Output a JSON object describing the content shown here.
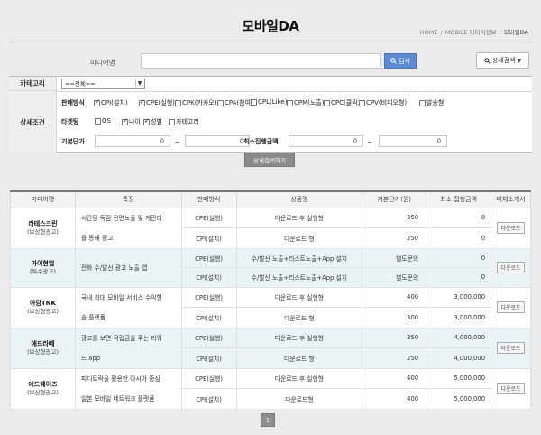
{
  "header": {
    "title": "모바일DA",
    "breadcrumb": [
      "HOME",
      "MOBILE 미디어정보",
      "모바일DA"
    ]
  },
  "search": {
    "media_label": "미디어명",
    "media_value": "",
    "search_button": "검색",
    "advanced_toggle": "상세검색"
  },
  "conditions": {
    "category_label": "카테고리",
    "category_selected": "==전체==",
    "detail_label": "상세조건",
    "sale_label": "판매방식",
    "sale_options": [
      {
        "label": "CPI(설치)",
        "checked": true
      },
      {
        "label": "CPE(실행)",
        "checked": true
      },
      {
        "label": "CPK(카카오)",
        "checked": false
      },
      {
        "label": "CPA(참여)",
        "checked": false
      },
      {
        "label": "CPL(Like)",
        "checked": false
      },
      {
        "label": "CPM(노출)",
        "checked": false
      },
      {
        "label": "CPC(클릭)",
        "checked": false
      },
      {
        "label": "CPV(비디오형)",
        "checked": false
      },
      {
        "label": "발송형",
        "checked": false
      }
    ],
    "target_label": "타겟팅",
    "target_options": [
      {
        "label": "OS",
        "checked": false
      },
      {
        "label": "나이",
        "checked": true
      },
      {
        "label": "성별",
        "checked": true
      },
      {
        "label": "카테고리",
        "checked": false
      }
    ],
    "price_label": "기본단가",
    "price_from": "0",
    "price_to": "0",
    "min_label": "최소집행금액",
    "min_from": "0",
    "min_to": "0",
    "tilde": "~",
    "submit": "상세검색하기"
  },
  "table": {
    "headers": [
      "미디어명",
      "특징",
      "판매방식",
      "상품명",
      "기본단가(원)",
      "최소 집행금액",
      "매체소개서"
    ],
    "download": "다운로드",
    "media": [
      {
        "name": "라테스크린",
        "sub": "(보상형광고)",
        "feature": [
          "시간당 독점 전면노출 및 계란티",
          "를 통해 광고"
        ],
        "rows": [
          {
            "sale": "CPE(실행)",
            "product": "다운로드 후 실행형",
            "price": "350",
            "min": "0"
          },
          {
            "sale": "CPI(설치)",
            "product": "다운로드 형",
            "price": "250",
            "min": "0"
          }
        ]
      },
      {
        "name": "마이현업",
        "sub": "(특수광고)",
        "feature": [
          "전화 수/발신 광고 노출 앱"
        ],
        "rows": [
          {
            "sale": "CPE(실행)",
            "product": "수/발신 노출+리스트노출+App 설치",
            "price": "별도문의",
            "min": "0"
          },
          {
            "sale": "CPI(설치)",
            "product": "수/발신 노출+리스트노출+App 설치",
            "price": "별도문의",
            "min": "0"
          }
        ]
      },
      {
        "name": "아담TNK",
        "sub": "(보상형광고)",
        "feature": [
          "국내 최대 모바일 서비스 수익형",
          "솔 플랫폼"
        ],
        "rows": [
          {
            "sale": "CPE(실행)",
            "product": "다운로드 후 실행형",
            "price": "400",
            "min": "3,000,000"
          },
          {
            "sale": "CPI(설치)",
            "product": "다운로드 형",
            "price": "300",
            "min": "3,000,000"
          }
        ]
      },
      {
        "name": "애드라떼",
        "sub": "(보상형광고)",
        "feature": [
          "광고를 보면 적립금을 주는 리워",
          "드 app"
        ],
        "rows": [
          {
            "sale": "CPE(실행)",
            "product": "다운로드 후 실행형",
            "price": "350",
            "min": "4,000,000"
          },
          {
            "sale": "CPI(설치)",
            "product": "다운로드 형",
            "price": "250",
            "min": "4,000,000"
          }
        ]
      },
      {
        "name": "애드웨이즈",
        "sub": "(보상형광고)",
        "feature": [
          "피디트락을 활용한 아시아 중심",
          "일본 모바일 네트워크 플랫폼"
        ],
        "rows": [
          {
            "sale": "CPE(실행)",
            "product": "다운로드 후 실행형",
            "price": "400",
            "min": "5,000,000"
          },
          {
            "sale": "CPI(설치)",
            "product": "다운로드형",
            "price": "400",
            "min": "5,000,000"
          }
        ]
      }
    ]
  },
  "pager": {
    "current": "1"
  }
}
